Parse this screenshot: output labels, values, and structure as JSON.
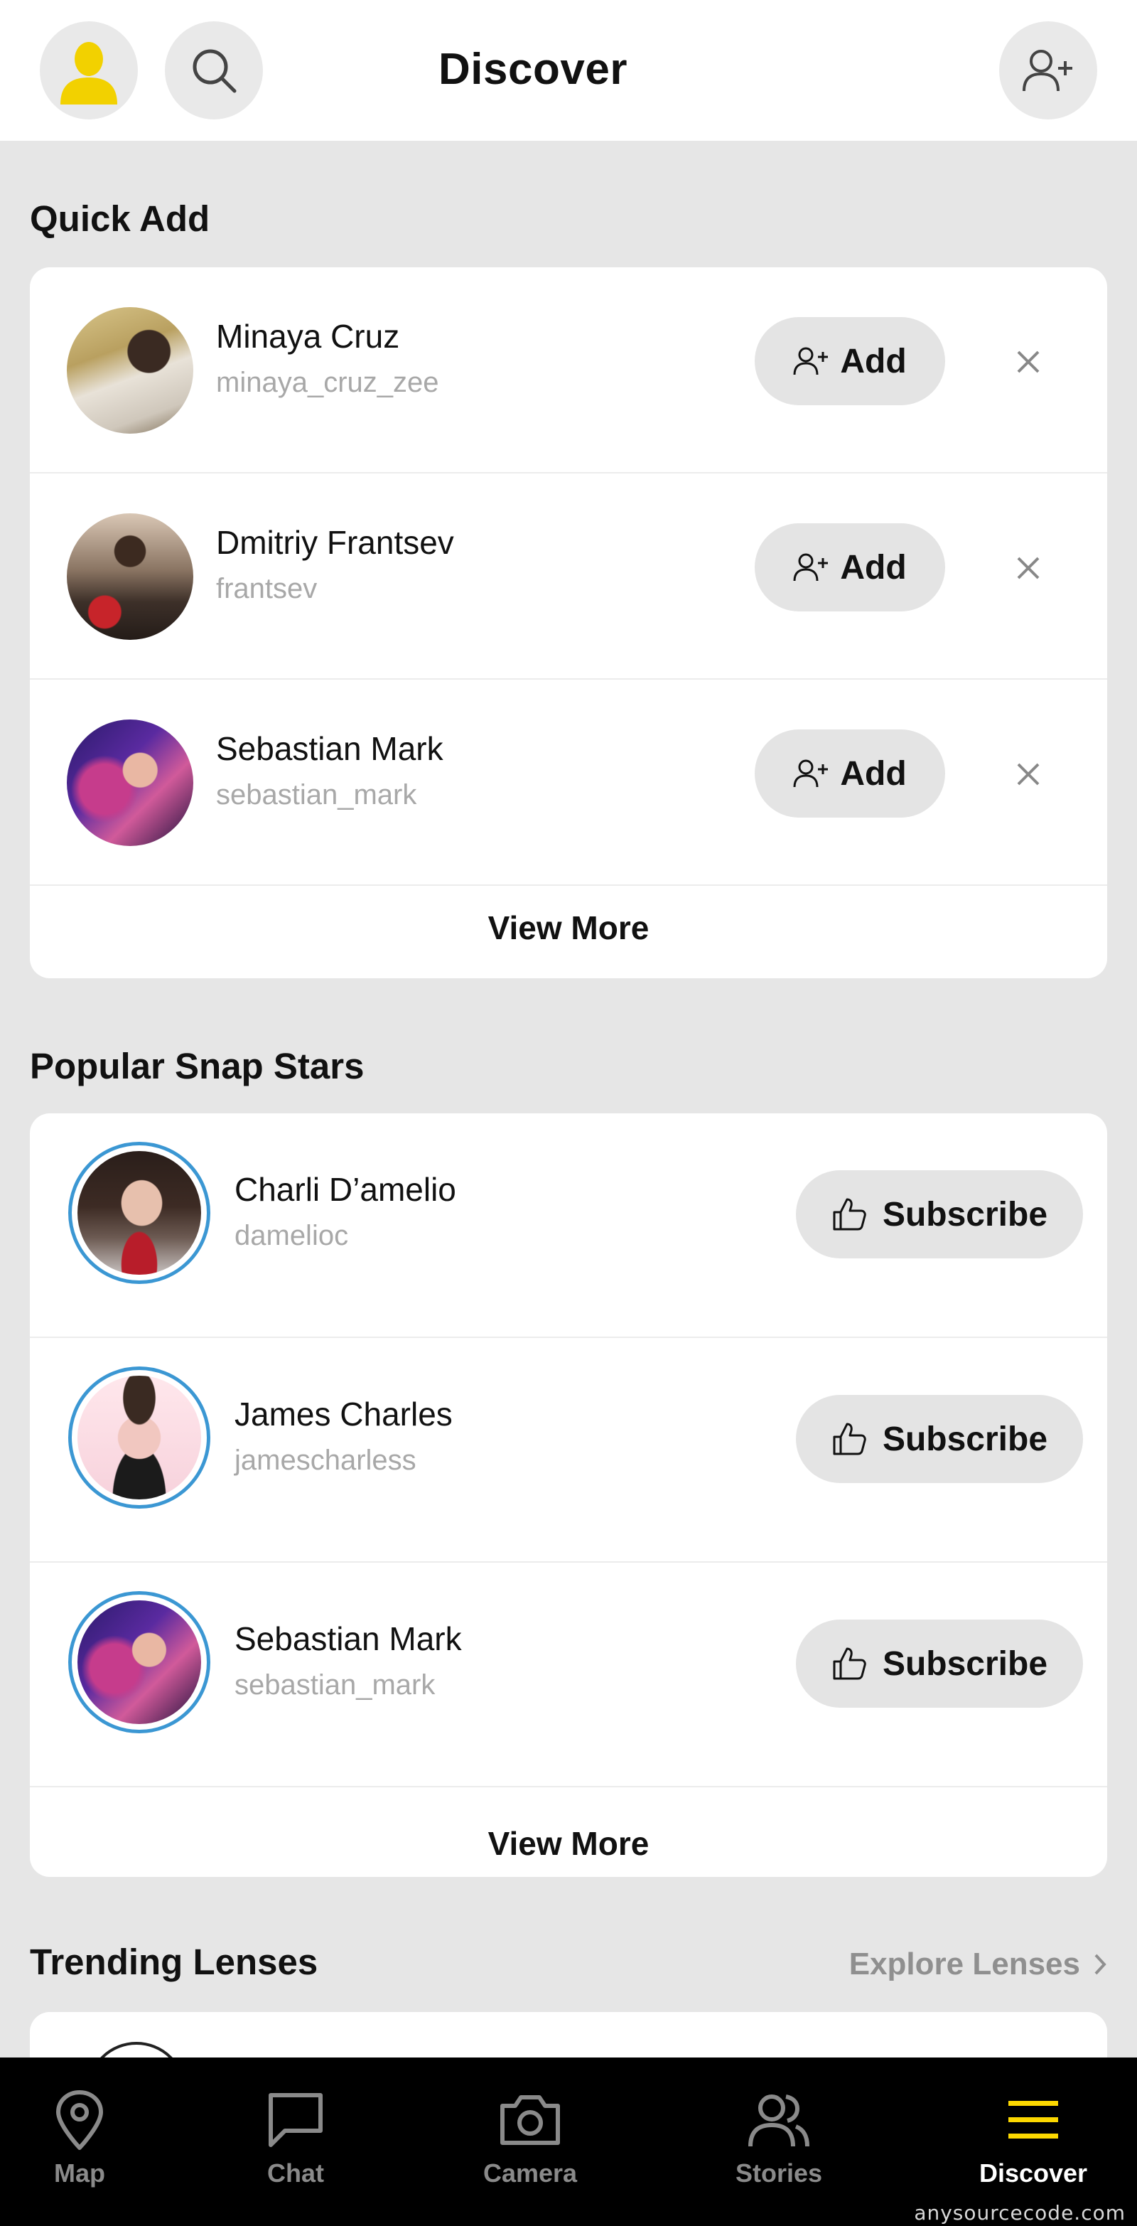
{
  "header": {
    "title": "Discover",
    "avatar_icon": "bitmoji-avatar-icon",
    "search_icon": "search-icon",
    "add_friend_icon": "add-friend-icon"
  },
  "colors": {
    "accent": "#fcd800",
    "ring": "#3b97d3",
    "card_bg": "#ffffff",
    "page_bg": "#e6e6e6",
    "nav_bg": "#000000"
  },
  "quick_add": {
    "title": "Quick Add",
    "add_label": "Add",
    "view_more": "View More",
    "items": [
      {
        "name": "Minaya Cruz",
        "username": "minaya_cruz_zee"
      },
      {
        "name": "Dmitriy Frantsev",
        "username": "frantsev"
      },
      {
        "name": "Sebastian Mark",
        "username": "sebastian_mark"
      }
    ]
  },
  "snap_stars": {
    "title": "Popular Snap Stars",
    "subscribe_label": "Subscribe",
    "view_more": "View More",
    "items": [
      {
        "name": "Charli D’amelio",
        "username": "damelioc"
      },
      {
        "name": "James Charles",
        "username": "jamescharless"
      },
      {
        "name": "Sebastian Mark",
        "username": "sebastian_mark"
      }
    ]
  },
  "trending": {
    "title": "Trending Lenses",
    "explore_label": "Explore Lenses"
  },
  "bottom_nav": {
    "items": [
      {
        "label": "Map",
        "icon": "map-pin-icon"
      },
      {
        "label": "Chat",
        "icon": "chat-icon"
      },
      {
        "label": "Camera",
        "icon": "camera-icon"
      },
      {
        "label": "Stories",
        "icon": "stories-icon"
      },
      {
        "label": "Discover",
        "icon": "menu-icon",
        "active": true
      }
    ]
  },
  "watermark": "anysourcecode.com"
}
